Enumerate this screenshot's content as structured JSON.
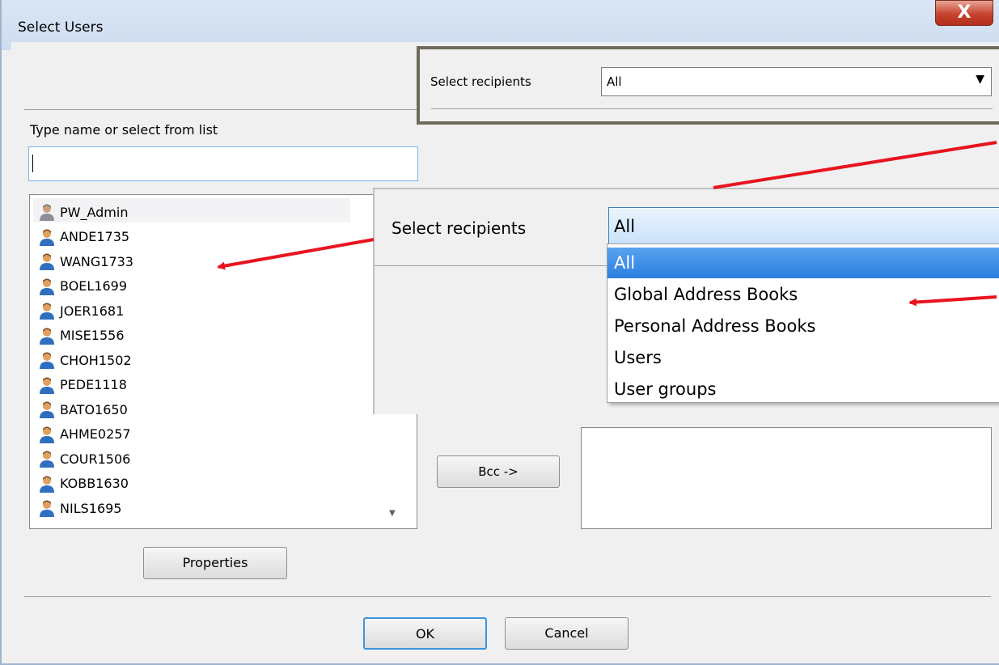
{
  "dialog": {
    "title": "Select Users",
    "close_glyph": "X"
  },
  "recipients": {
    "label": "Select recipients",
    "selected": "All"
  },
  "search": {
    "label": "Type name or select from list",
    "value": ""
  },
  "users": [
    {
      "name": "PW_Admin",
      "icon": "admin-user-icon"
    },
    {
      "name": "ANDE1735",
      "icon": "user-icon"
    },
    {
      "name": "WANG1733",
      "icon": "user-icon"
    },
    {
      "name": "BOEL1699",
      "icon": "user-icon"
    },
    {
      "name": "JOER1681",
      "icon": "user-icon"
    },
    {
      "name": "MISE1556",
      "icon": "user-icon"
    },
    {
      "name": "CHOH1502",
      "icon": "user-icon"
    },
    {
      "name": "PEDE1118",
      "icon": "user-icon"
    },
    {
      "name": "BATO1650",
      "icon": "user-icon"
    },
    {
      "name": "AHME0257",
      "icon": "user-icon"
    },
    {
      "name": "COUR1506",
      "icon": "user-icon"
    },
    {
      "name": "KOBB1630",
      "icon": "user-icon"
    },
    {
      "name": "NILS1695",
      "icon": "user-icon"
    }
  ],
  "buttons": {
    "bcc": "Bcc ->",
    "properties": "Properties",
    "ok": "OK",
    "cancel": "Cancel"
  },
  "zoom": {
    "label": "Select recipients",
    "selected": "All",
    "options": [
      "All",
      "Global Address Books",
      "Personal Address Books",
      "Users",
      "User groups"
    ],
    "highlighted": "All"
  },
  "colors": {
    "annotation_arrow": "#e8141e",
    "highlight": "#3a8ee6",
    "callout_border": "#6e6a5c"
  }
}
